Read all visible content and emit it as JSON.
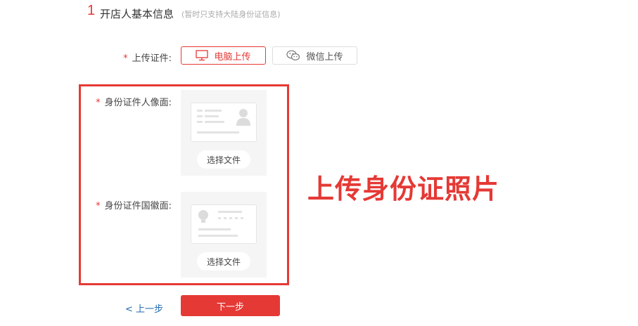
{
  "header": {
    "step_number": "1",
    "title": "开店人基本信息",
    "note": "(暂时只支持大陆身份证信息)"
  },
  "upload": {
    "required_mark": "*",
    "label": "上传证件:",
    "pc_label": "电脑上传",
    "wechat_label": "微信上传",
    "icons": {
      "pc": "monitor-icon",
      "wechat": "wechat-icon"
    }
  },
  "id_front": {
    "required_mark": "*",
    "label": "身份证件人像面:",
    "button_label": "选择文件",
    "icon": "id-card-portrait-icon"
  },
  "id_back": {
    "required_mark": "*",
    "label": "身份证件国徽面:",
    "button_label": "选择文件",
    "icon": "id-card-emblem-icon"
  },
  "annotation": {
    "text": "上传身份证照片"
  },
  "footer": {
    "prev_label": "< 上一步",
    "next_label": "下一步"
  },
  "colors": {
    "accent": "#e53935",
    "link": "#1e6ab0",
    "placeholder_bg": "#f5f5f5"
  }
}
